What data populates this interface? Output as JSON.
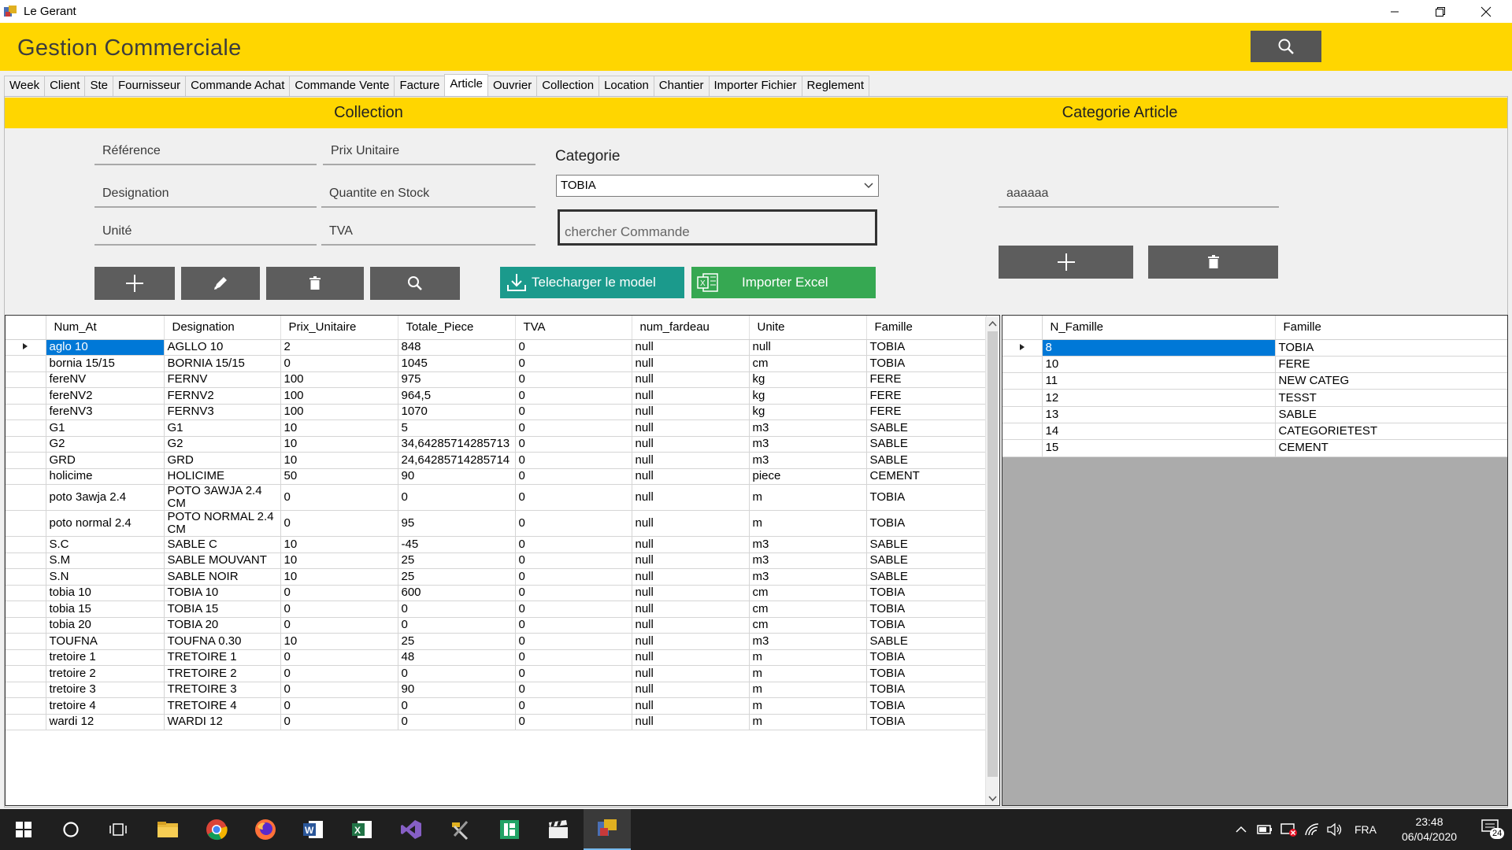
{
  "window": {
    "title": "Le Gerant"
  },
  "header": {
    "brand": "Gestion Commerciale"
  },
  "tabs": [
    "Week",
    "Client",
    "Ste",
    "Fournisseur",
    "Commande Achat",
    "Commande Vente",
    "Facture",
    "Article",
    "Ouvrier",
    "Collection",
    "Location",
    "Chantier",
    "Importer Fichier",
    "Reglement"
  ],
  "active_tab": "Article",
  "collection": {
    "title": "Collection",
    "fields": {
      "reference": "Référence",
      "prix_unitaire": "Prix Unitaire",
      "designation": "Designation",
      "quantite": "Quantite en Stock",
      "unite": "Unité",
      "tva": "TVA"
    },
    "categorie_label": "Categorie",
    "categorie_selected": "TOBIA",
    "search_placeholder": "chercher Commande",
    "download_label": "Telecharger le model",
    "import_label": "Importer Excel"
  },
  "categorie_article": {
    "title": "Categorie Article",
    "input_value": "aaaaaa"
  },
  "articles_grid": {
    "columns": [
      "Num_At",
      "Designation",
      "Prix_Unitaire",
      "Totale_Piece",
      "TVA",
      "num_fardeau",
      "Unite",
      "Famille"
    ],
    "rows": [
      [
        "aglo 10",
        "AGLLO 10",
        "2",
        "848",
        "0",
        "null",
        "null",
        "TOBIA"
      ],
      [
        "bornia 15/15",
        "BORNIA 15/15",
        "0",
        "1045",
        "0",
        "null",
        "cm",
        "TOBIA"
      ],
      [
        "fereNV",
        "FERNV",
        "100",
        "975",
        "0",
        "null",
        "kg",
        "FERE"
      ],
      [
        "fereNV2",
        "FERNV2",
        "100",
        "964,5",
        "0",
        "null",
        "kg",
        "FERE"
      ],
      [
        "fereNV3",
        "FERNV3",
        "100",
        "1070",
        "0",
        "null",
        "kg",
        "FERE"
      ],
      [
        "G1",
        "G1",
        "10",
        "5",
        "0",
        "null",
        "m3",
        "SABLE"
      ],
      [
        "G2",
        "G2",
        "10",
        "34,64285714285713",
        "0",
        "null",
        "m3",
        "SABLE"
      ],
      [
        "GRD",
        "GRD",
        "10",
        "24,64285714285714",
        "0",
        "null",
        "m3",
        "SABLE"
      ],
      [
        "holicime",
        "HOLICIME",
        "50",
        "90",
        "0",
        "null",
        "piece",
        "CEMENT"
      ],
      [
        "poto 3awja 2.4",
        "POTO 3AWJA 2.4 CM",
        "0",
        "0",
        "0",
        "null",
        "m",
        "TOBIA"
      ],
      [
        "poto normal 2.4",
        "POTO NORMAL 2.4 CM",
        "0",
        "95",
        "0",
        "null",
        "m",
        "TOBIA"
      ],
      [
        "S.C",
        "SABLE C",
        "10",
        "-45",
        "0",
        "null",
        "m3",
        "SABLE"
      ],
      [
        "S.M",
        "SABLE MOUVANT",
        "10",
        "25",
        "0",
        "null",
        "m3",
        "SABLE"
      ],
      [
        "S.N",
        "SABLE NOIR",
        "10",
        "25",
        "0",
        "null",
        "m3",
        "SABLE"
      ],
      [
        "tobia 10",
        "TOBIA 10",
        "0",
        "600",
        "0",
        "null",
        "cm",
        "TOBIA"
      ],
      [
        "tobia 15",
        "TOBIA 15",
        "0",
        "0",
        "0",
        "null",
        "cm",
        "TOBIA"
      ],
      [
        "tobia 20",
        "TOBIA 20",
        "0",
        "0",
        "0",
        "null",
        "cm",
        "TOBIA"
      ],
      [
        "TOUFNA",
        "TOUFNA 0.30",
        "10",
        "25",
        "0",
        "null",
        "m3",
        "SABLE"
      ],
      [
        "tretoire 1",
        "TRETOIRE 1",
        "0",
        "48",
        "0",
        "null",
        "m",
        "TOBIA"
      ],
      [
        "tretoire 2",
        "TRETOIRE 2",
        "0",
        "0",
        "0",
        "null",
        "m",
        "TOBIA"
      ],
      [
        "tretoire 3",
        "TRETOIRE 3",
        "0",
        "90",
        "0",
        "null",
        "m",
        "TOBIA"
      ],
      [
        "tretoire 4",
        "TRETOIRE 4",
        "0",
        "0",
        "0",
        "null",
        "m",
        "TOBIA"
      ],
      [
        "wardi 12",
        "WARDI 12",
        "0",
        "0",
        "0",
        "null",
        "m",
        "TOBIA"
      ]
    ]
  },
  "famille_grid": {
    "columns": [
      "N_Famille",
      "Famille"
    ],
    "rows": [
      [
        "8",
        "TOBIA"
      ],
      [
        "10",
        "FERE"
      ],
      [
        "11",
        "NEW CATEG"
      ],
      [
        "12",
        "TESST"
      ],
      [
        "13",
        "SABLE"
      ],
      [
        "14",
        "CATEGORIETEST"
      ],
      [
        "15",
        "CEMENT"
      ]
    ]
  },
  "taskbar": {
    "language": "FRA",
    "time": "23:48",
    "date": "06/04/2020",
    "notifications": "24"
  },
  "colors": {
    "accent_yellow": "#ffd600",
    "button_gray": "#5d5d5d",
    "teal": "#1b9a8c",
    "green": "#36a852",
    "selection": "#0078d7"
  }
}
